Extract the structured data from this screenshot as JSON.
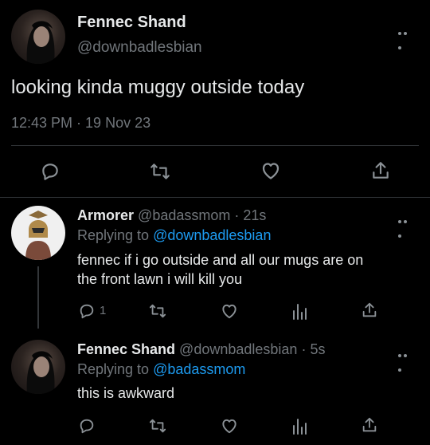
{
  "main_tweet": {
    "author": "Fennec Shand",
    "handle": "@downbadlesbian",
    "text": "looking kinda muggy outside today",
    "meta": "12:43 PM · 19 Nov 23"
  },
  "replies": [
    {
      "author": "Armorer",
      "handle": "@badassmom",
      "time": "· 21s",
      "replying_prefix": "Replying to",
      "replying_to": "@downbadlesbian",
      "text_line1": "fennec if i go outside and all our mugs are on",
      "text_line2": "the front lawn i will kill you",
      "reply_count": "1"
    },
    {
      "author": "Fennec Shand",
      "handle": "@downbadlesbian",
      "time": "· 5s",
      "replying_prefix": "Replying to",
      "replying_to": "@badassmom",
      "text": "this is awkward"
    }
  ],
  "icons": [
    "more-icon",
    "reply-icon",
    "retweet-icon",
    "like-icon",
    "share-icon",
    "analytics-icon"
  ],
  "colors": {
    "background": "#000000",
    "text": "#e7e9ea",
    "muted": "#71767b",
    "link": "#1d9bf0",
    "divider": "#2f3336"
  }
}
